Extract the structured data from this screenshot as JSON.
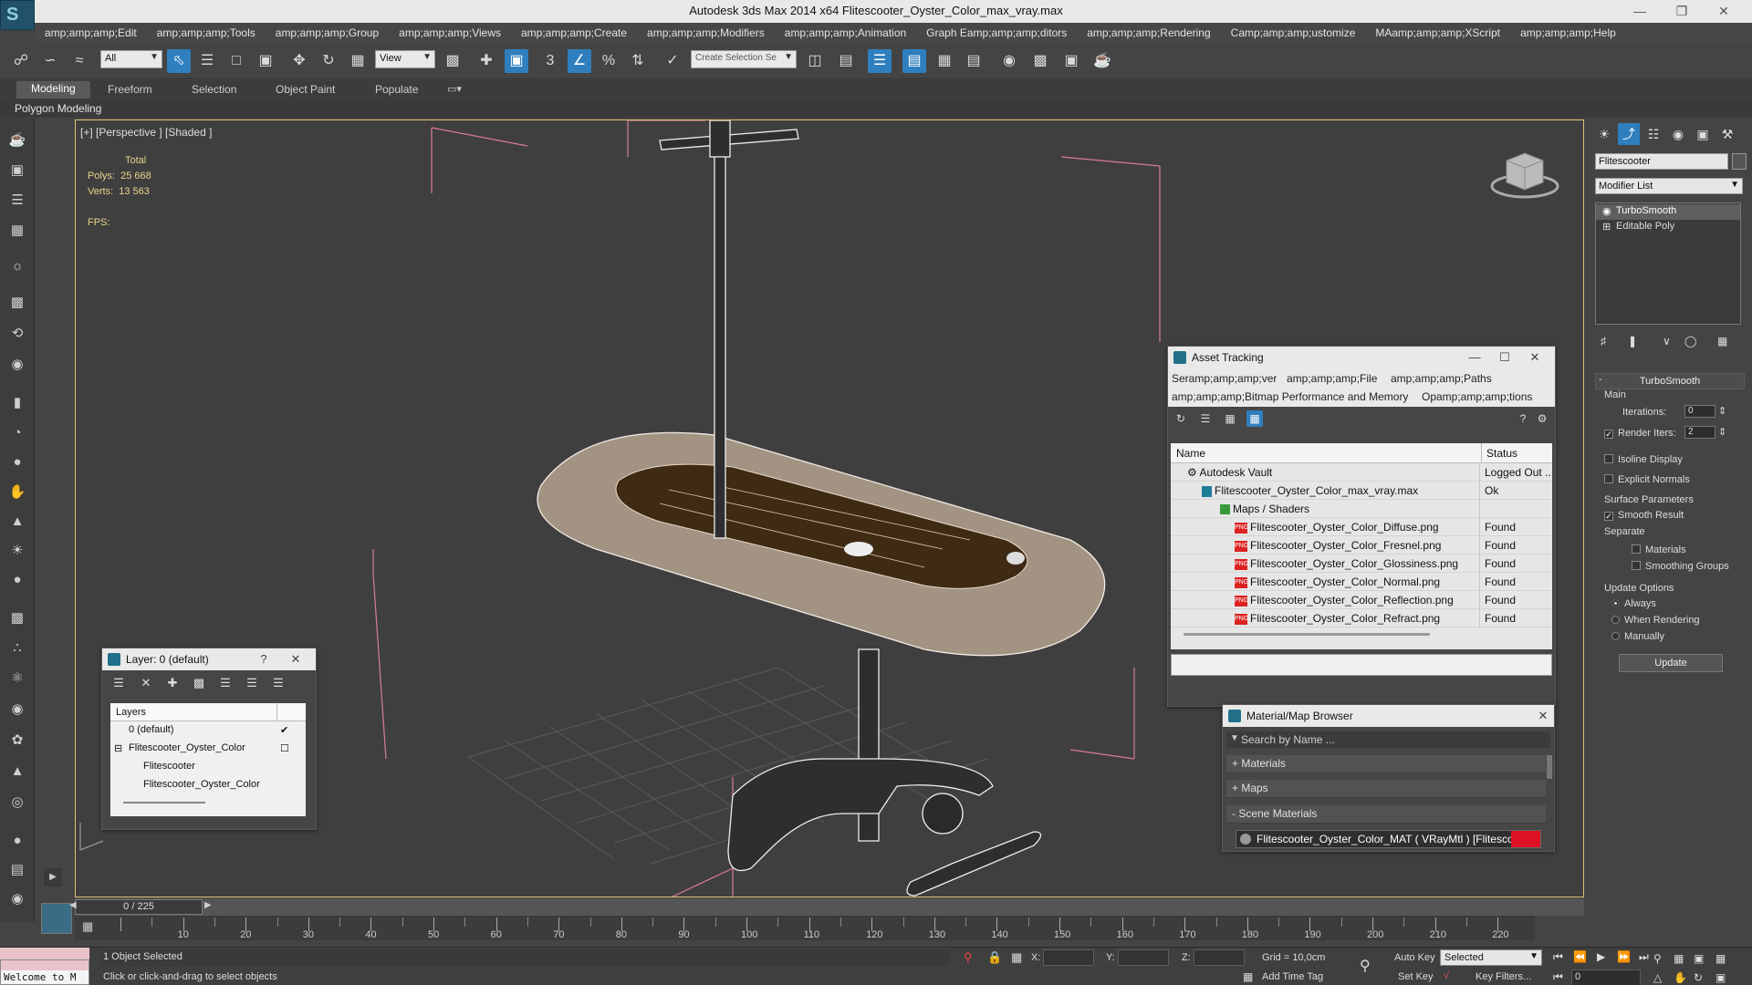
{
  "app": {
    "title": "Autodesk 3ds Max  2014 x64     Flitescooter_Oyster_Color_max_vray.max"
  },
  "menus": [
    "amp;amp;amp;Edit",
    "amp;amp;amp;Tools",
    "amp;amp;amp;Group",
    "amp;amp;amp;Views",
    "amp;amp;amp;Create",
    "amp;amp;amp;Modifiers",
    "amp;amp;amp;Animation",
    "Graph Eamp;amp;amp;ditors",
    "amp;amp;amp;Rendering",
    "Camp;amp;amp;ustomize",
    "MAamp;amp;amp;XScript",
    "amp;amp;amp;Help"
  ],
  "toolbar": {
    "filter_value": "All",
    "refcoord_value": "View",
    "named_sel_placeholder": "Create Selection Se"
  },
  "ribbon": {
    "tabs": [
      "Modeling",
      "Freeform",
      "Selection",
      "Object Paint",
      "Populate"
    ],
    "panel_label": "Polygon Modeling"
  },
  "viewport": {
    "label": "[+] [Perspective ] [Shaded ]",
    "stats_total": "Total",
    "polys_label": "Polys:",
    "polys_value": "25 668",
    "verts_label": "Verts:",
    "verts_value": "13 563",
    "fps_label": "FPS:"
  },
  "asset_tracking": {
    "title": "Asset Tracking",
    "menu": [
      "Seramp;amp;amp;ver",
      "amp;amp;amp;File",
      "amp;amp;amp;Paths",
      "amp;amp;amp;Bitmap Performance and Memory",
      "Opamp;amp;amp;tions"
    ],
    "col_name": "Name",
    "col_status": "Status",
    "rows": [
      {
        "name": "Autodesk Vault",
        "status": "Logged Out ..."
      },
      {
        "name": "Flitescooter_Oyster_Color_max_vray.max",
        "status": "Ok"
      },
      {
        "name": "Maps / Shaders",
        "status": ""
      },
      {
        "name": "Flitescooter_Oyster_Color_Diffuse.png",
        "status": "Found"
      },
      {
        "name": "Flitescooter_Oyster_Color_Fresnel.png",
        "status": "Found"
      },
      {
        "name": "Flitescooter_Oyster_Color_Glossiness.png",
        "status": "Found"
      },
      {
        "name": "Flitescooter_Oyster_Color_Normal.png",
        "status": "Found"
      },
      {
        "name": "Flitescooter_Oyster_Color_Reflection.png",
        "status": "Found"
      },
      {
        "name": "Flitescooter_Oyster_Color_Refract.png",
        "status": "Found"
      }
    ]
  },
  "material_browser": {
    "title": "Material/Map Browser",
    "search_placeholder": "Search by Name ...",
    "groups": [
      "+ Materials",
      "+ Maps",
      "- Scene Materials"
    ],
    "item": "Flitescooter_Oyster_Color_MAT ( VRayMtl ) [Flitescooter]"
  },
  "layer_window": {
    "title": "Layer: 0 (default)",
    "help": "?",
    "col_layers": "Layers",
    "rows": [
      "0 (default)",
      "Flitescooter_Oyster_Color",
      "Flitescooter",
      "Flitescooter_Oyster_Color"
    ]
  },
  "command_panel": {
    "object_name": "Flitescooter",
    "modifier_list": "Modifier List",
    "stack": [
      "TurboSmooth",
      "Editable Poly"
    ],
    "rollout_title": "TurboSmooth",
    "main_label": "Main",
    "iterations_label": "Iterations:",
    "iterations_value": "0",
    "render_iters_label": "Render Iters:",
    "render_iters_value": "2",
    "isoline": "Isoline Display",
    "explicit": "Explicit Normals",
    "surface_params": "Surface Parameters",
    "smooth_result": "Smooth Result",
    "separate": "Separate",
    "materials": "Materials",
    "smoothing_groups": "Smoothing Groups",
    "update_options": "Update Options",
    "always": "Always",
    "when_rendering": "When Rendering",
    "manually": "Manually",
    "update_button": "Update"
  },
  "timeline": {
    "frame": "0 / 225",
    "ticks": [
      "10",
      "20",
      "30",
      "40",
      "50",
      "60",
      "70",
      "80",
      "90",
      "100",
      "110",
      "120",
      "130",
      "140",
      "150",
      "160",
      "170",
      "180",
      "190",
      "200",
      "210",
      "220"
    ]
  },
  "status": {
    "selected": "1 Object Selected",
    "prompt": "Click or click-and-drag to select objects",
    "x_label": "X:",
    "y_label": "Y:",
    "z_label": "Z:",
    "grid": "Grid = 10,0cm",
    "add_time_tag": "Add Time Tag",
    "auto_key": "Auto Key",
    "set_key": "Set Key",
    "key_mode": "Selected",
    "key_filters": "Key Filters...",
    "frame_field": "0",
    "maxscript": "Welcome to M"
  }
}
